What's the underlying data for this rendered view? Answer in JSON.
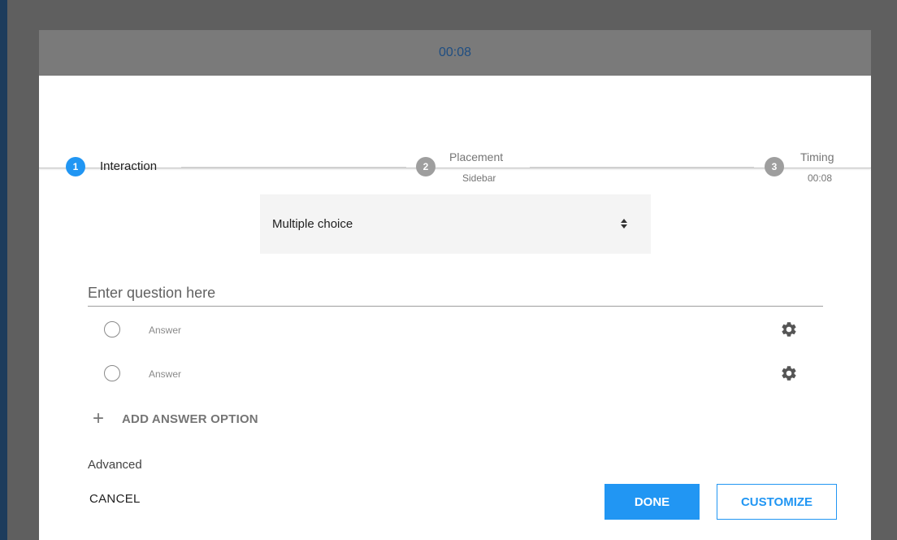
{
  "timer": {
    "value": "00:08",
    "color": "#1f4e82"
  },
  "stepper": {
    "steps": [
      {
        "number": "1",
        "label": "Interaction",
        "sub": "",
        "state": "active"
      },
      {
        "number": "2",
        "label": "Placement",
        "sub": "Sidebar",
        "state": "inactive"
      },
      {
        "number": "3",
        "label": "Timing",
        "sub": "00:08",
        "state": "inactive"
      }
    ]
  },
  "question_type": {
    "selected": "Multiple choice"
  },
  "question": {
    "placeholder": "Enter question here",
    "value": ""
  },
  "answers": [
    {
      "placeholder": "Answer",
      "icon": "gear-icon"
    },
    {
      "placeholder": "Answer",
      "icon": "gear-icon"
    }
  ],
  "add_option": {
    "label": "ADD ANSWER OPTION",
    "icon": "plus-icon"
  },
  "advanced": {
    "label": "Advanced"
  },
  "actions": {
    "cancel": "CANCEL",
    "done": "DONE",
    "customize": "CUSTOMIZE"
  },
  "colors": {
    "accent": "#2196f3",
    "overlay": "#5f5f5f",
    "step_inactive": "#9e9e9e"
  }
}
